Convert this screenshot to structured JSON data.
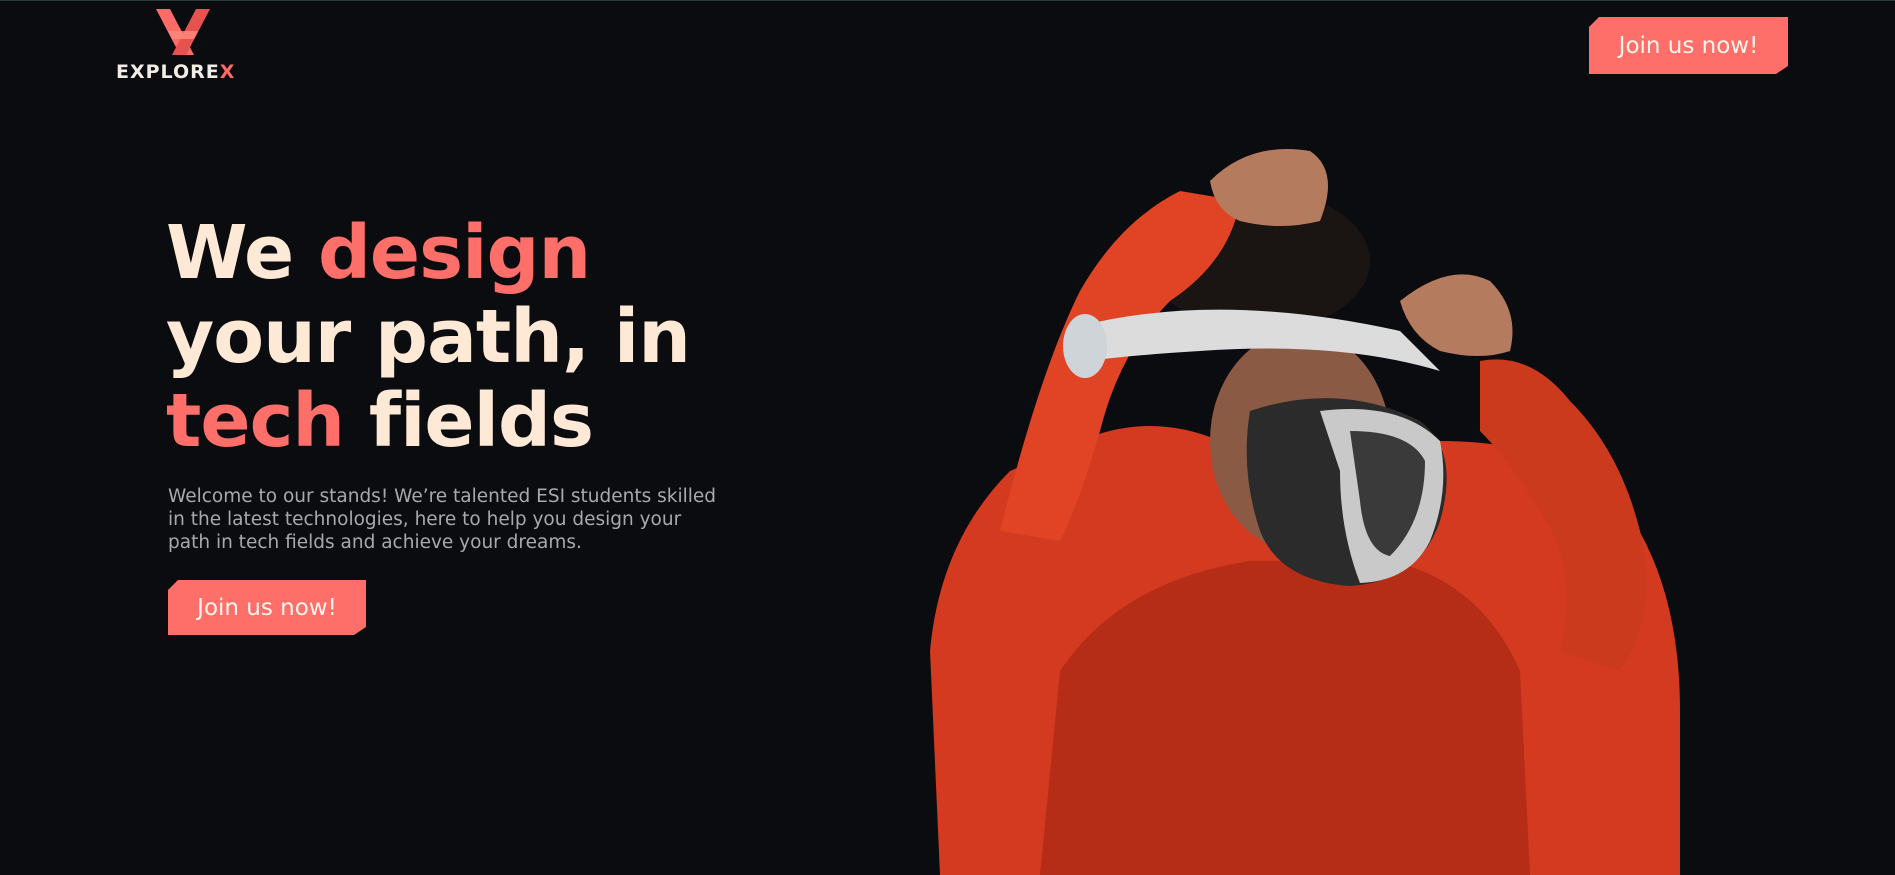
{
  "header": {
    "logo": {
      "mark_icon": "x-logo-icon",
      "text_main": "EXPLORE",
      "text_accent": "X"
    },
    "cta_label": "Join us now!"
  },
  "hero": {
    "headline": {
      "part1": "We ",
      "accent1": "design",
      "part2": " your path, in ",
      "accent2": "tech",
      "part3": " fields"
    },
    "description": "Welcome to our stands! We’re talented ESI students skilled in the latest technologies, here to help you design your path in tech fields and achieve your dreams.",
    "cta_label": "Join us now!",
    "image_icon": "person-vr-headset-photo"
  },
  "colors": {
    "background": "#0b0c10",
    "accent": "#ff6f69",
    "headline": "#fde9d6",
    "body_text": "#a8a9ae"
  }
}
